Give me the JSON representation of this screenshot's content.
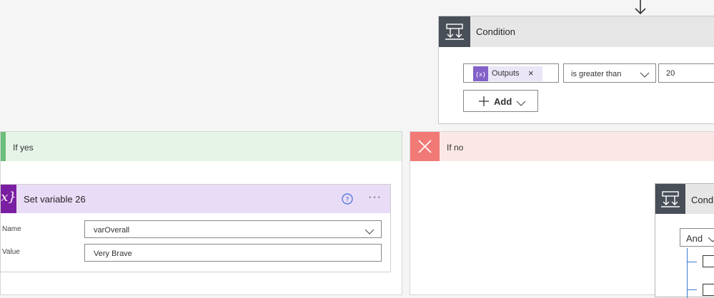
{
  "condition": {
    "title": "Condition",
    "token_label": "Outputs",
    "token_remove": "×",
    "operator": "is greater than",
    "value": "20",
    "add_label": "Add"
  },
  "branches": {
    "yes_label": "If yes",
    "no_label": "If no"
  },
  "set_variable": {
    "title": "Set variable 26",
    "icon_glyph": "x}",
    "more": "···",
    "name_label": "Name",
    "name_value": "varOverall",
    "value_label": "Value",
    "value_value": "Very Brave"
  },
  "nested_condition": {
    "title": "Condition",
    "group_operator": "And"
  },
  "icons": [
    "down-arrow-icon",
    "condition-icon",
    "variable-icon",
    "help-icon",
    "more-icon",
    "plus-icon",
    "chevron-down-icon",
    "close-icon",
    "checkbox-icon"
  ],
  "colors": {
    "condition_header": "#484f58",
    "token_purple": "#8361c8",
    "yes_green": "#6bbf7a",
    "no_red": "#f17a77",
    "variable_purple": "#7b1fa2",
    "variable_header": "#e9dcf7",
    "link_blue": "#3b7bd4"
  }
}
